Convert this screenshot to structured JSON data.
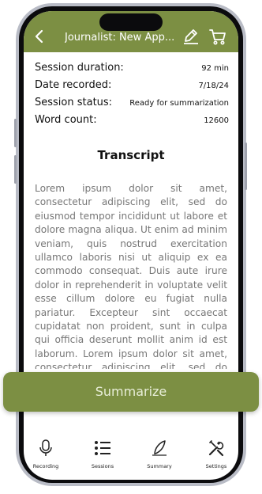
{
  "header": {
    "back_icon": "chevron-left-icon",
    "title": "Journalist: New App...",
    "edit_icon": "pencil-icon",
    "cart_icon": "cart-icon"
  },
  "session": {
    "duration_label": "Session duration:",
    "duration_value": "92 min",
    "date_label": "Date recorded:",
    "date_value": "7/18/24",
    "status_label": "Session status:",
    "status_value": "Ready for summarization",
    "wordcount_label": "Word count:",
    "wordcount_value": "12600"
  },
  "transcript": {
    "heading": "Transcript",
    "text": "Lorem ipsum dolor sit amet, consectetur adipiscing elit, sed do eiusmod tempor incididunt ut labore et dolore magna aliqua. Ut enim ad minim veniam, quis nostrud exercitation ullamco laboris nisi ut aliquip ex ea commodo consequat. Duis aute irure dolor in reprehenderit in voluptate velit esse cillum dolore eu fugiat nulla pariatur. Excepteur sint occaecat cupidatat non proident, sunt in culpa qui officia deserunt mollit anim id est laborum. Lorem ipsum dolor sit amet, consectetur adipiscing elit, sed do eiusmod tempor incididunt ut labore et."
  },
  "actions": {
    "summarize_label": "Summarize"
  },
  "tabs": [
    {
      "label": "Recording",
      "icon": "microphone-icon"
    },
    {
      "label": "Sessions",
      "icon": "list-icon"
    },
    {
      "label": "Summary",
      "icon": "quill-icon"
    },
    {
      "label": "Settings",
      "icon": "tools-icon"
    }
  ],
  "colors": {
    "brand": "#7c8f43",
    "button_text": "#e8eed8",
    "transcript_text": "#777777"
  }
}
